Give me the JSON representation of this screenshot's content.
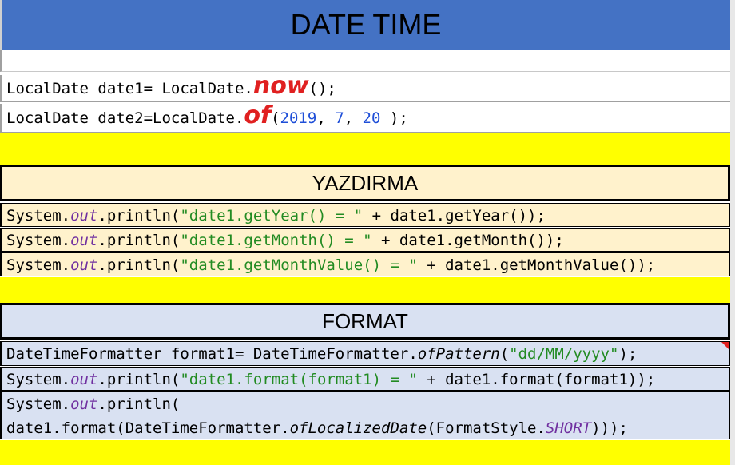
{
  "title": "DATE TIME",
  "section1": {
    "line1": {
      "pre": "LocalDate date1= LocalDate.",
      "method": "now",
      "post": "();"
    },
    "line2": {
      "pre": "LocalDate date2=LocalDate.",
      "method": "of",
      "open": "(",
      "a": "2019",
      "sep1": ", ",
      "b": "7",
      "sep2": ", ",
      "c": "20",
      "close": " );"
    }
  },
  "yazdirma": {
    "header": "YAZDIRMA",
    "lines": [
      {
        "pre": "System.",
        "out": "out",
        "mid": ".println(",
        "str": "\"date1.getYear() = \"",
        "post": " + date1.getYear());"
      },
      {
        "pre": "System.",
        "out": "out",
        "mid": ".println(",
        "str": "\"date1.getMonth() = \"",
        "post": " + date1.getMonth());"
      },
      {
        "pre": "System.",
        "out": "out",
        "mid": ".println(",
        "str": "\"date1.getMonthValue() = \"",
        "post": " + date1.getMonthValue());"
      }
    ]
  },
  "format": {
    "header": "FORMAT",
    "line1": {
      "pre": "DateTimeFormatter format1= DateTimeFormatter.",
      "method": "ofPattern",
      "open": "(",
      "str": "\"dd/MM/yyyy\"",
      "post": ");"
    },
    "line2": {
      "pre": "System.",
      "out": "out",
      "mid": ".println(",
      "str": "\"date1.format(format1) = \"",
      "post": " + date1.format(format1));"
    },
    "line3a": {
      "pre": "System.",
      "out": "out",
      "mid": ".println("
    },
    "line3b": {
      "pre": "date1.format(DateTimeFormatter.",
      "method": "ofLocalizedDate",
      "mid": "(FormatStyle.",
      "const": "SHORT",
      "post": ")));"
    }
  },
  "colors": {
    "title_bg": "#4472c4",
    "yellow": "#ffff00",
    "peach": "#fff2cc",
    "lavender": "#d9e1f2",
    "string_green": "#228b22",
    "number_blue": "#1f4fd8",
    "static_purple": "#7030a0",
    "method_red": "#e02020"
  }
}
